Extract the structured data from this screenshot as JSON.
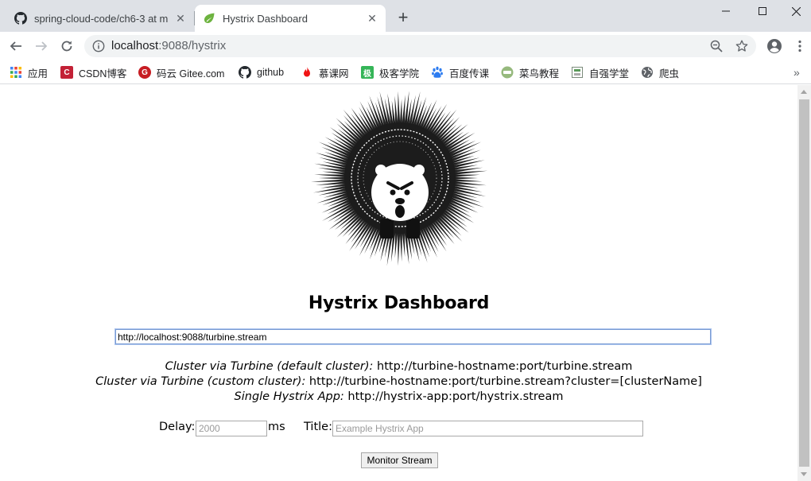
{
  "browser": {
    "tabs": [
      {
        "title": "spring-cloud-code/ch6-3 at m",
        "icon": "github-icon",
        "active": false
      },
      {
        "title": "Hystrix Dashboard",
        "icon": "spring-leaf-icon",
        "active": true
      }
    ],
    "address": {
      "host": "localhost",
      "rest": ":9088/hystrix"
    },
    "bookmarks": [
      {
        "label": "应用",
        "icon": "apps-grid-icon"
      },
      {
        "label": "CSDN博客",
        "icon": "csdn-icon",
        "color": "#c32136"
      },
      {
        "label": "码云 Gitee.com",
        "icon": "gitee-icon",
        "color": "#c71d23"
      },
      {
        "label": "github",
        "icon": "github-icon"
      },
      {
        "label": "慕课网",
        "icon": "flame-icon",
        "color": "#f01414"
      },
      {
        "label": "极客学院",
        "icon": "jike-icon",
        "color": "#35b558"
      },
      {
        "label": "百度传课",
        "icon": "paw-icon",
        "color": "#2d7cf0"
      },
      {
        "label": "菜鸟教程",
        "icon": "runoob-icon",
        "color": "#96b97d"
      },
      {
        "label": "自强学堂",
        "icon": "ziqiang-icon"
      },
      {
        "label": "爬虫",
        "icon": "globe-icon"
      }
    ]
  },
  "page": {
    "heading": "Hystrix Dashboard",
    "stream_url": "http://localhost:9088/turbine.stream",
    "help": [
      {
        "label": "Cluster via Turbine (default cluster):",
        "value": " http://turbine-hostname:port/turbine.stream"
      },
      {
        "label": "Cluster via Turbine (custom cluster):",
        "value": " http://turbine-hostname:port/turbine.stream?cluster=[clusterName]"
      },
      {
        "label": "Single Hystrix App:",
        "value": " http://hystrix-app:port/hystrix.stream"
      }
    ],
    "delay_label": "Delay:",
    "delay_placeholder": "2000",
    "delay_unit": "ms",
    "title_label": "Title:",
    "title_placeholder": "Example Hystrix App",
    "monitor_button": "Monitor Stream"
  }
}
